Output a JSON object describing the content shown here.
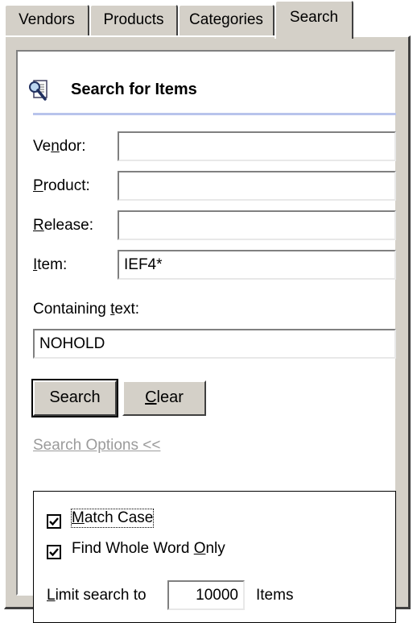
{
  "tabs": [
    {
      "label": "Vendors"
    },
    {
      "label": "Products"
    },
    {
      "label": "Categories"
    },
    {
      "label": "Search",
      "active": true
    }
  ],
  "header": {
    "title": "Search for Items",
    "icon": "search-document-icon"
  },
  "form": {
    "vendor": {
      "pre": "Ve",
      "key": "n",
      "post": "dor:",
      "value": ""
    },
    "product": {
      "pre": "",
      "key": "P",
      "post": "roduct:",
      "value": ""
    },
    "release": {
      "pre": "",
      "key": "R",
      "post": "elease:",
      "value": ""
    },
    "item": {
      "pre": "",
      "key": "I",
      "post": "tem:",
      "value": "IEF4*"
    },
    "containing": {
      "pre": "Containing ",
      "key": "t",
      "post": "ext:",
      "value": "NOHOLD"
    }
  },
  "buttons": {
    "search": "Search",
    "clear_pre": "",
    "clear_key": "C",
    "clear_post": "lear"
  },
  "search_options_link": "Search Options <<",
  "options": {
    "match_case": {
      "pre": "",
      "key": "M",
      "post": "atch Case",
      "checked": true
    },
    "whole_word": {
      "pre": "Find Whole Word ",
      "key": "O",
      "post": "nly",
      "checked": true
    },
    "limit_pre": "",
    "limit_key": "L",
    "limit_post": "imit search to",
    "limit_value": "10000",
    "limit_suffix": "Items"
  },
  "colors": {
    "face": "#d4d0c8",
    "separator": "#b8c4ec",
    "link_disabled": "#9b9b9b"
  }
}
